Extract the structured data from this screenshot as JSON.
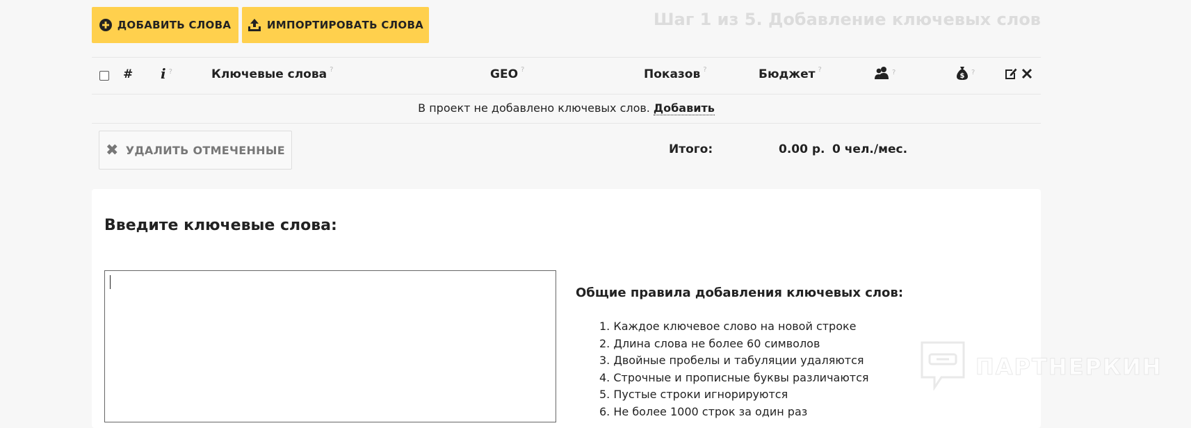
{
  "toolbar": {
    "add_label": "ДОБАВИТЬ СЛОВА",
    "import_label": "ИМПОРТИРОВАТЬ СЛОВА",
    "accent": "#ffd04d"
  },
  "step_title": "Шаг 1 из 5. Добавление ключевых слов",
  "table": {
    "columns": {
      "number": "#",
      "info": "i",
      "keywords": "Ключевые слова",
      "geo": "GEO",
      "impressions": "Показов",
      "budget": "Бюджет",
      "audience_icon": "users-icon",
      "money_icon": "money-bag-icon",
      "help": "?"
    },
    "empty_text": "В проект не добавлено ключевых слов.",
    "empty_link": "Добавить"
  },
  "delete_label": "УДАЛИТЬ ОТМЕЧЕННЫЕ",
  "totals": {
    "label": "Итого:",
    "budget": "0.00 р.",
    "audience": "0 чел./мес."
  },
  "input_section": {
    "title": "Введите ключевые слова:",
    "value": ""
  },
  "rules": {
    "title": "Общие правила добавления ключевых слов:",
    "items": [
      "1. Каждое ключевое слово на новой строке",
      "2. Длина слова не более 60 символов",
      "3. Двойные пробелы и табуляции удаляются",
      "4. Строчные и прописные буквы различаются",
      "5. Пустые строки игнорируются",
      "6. Не более 1000 строк за один раз"
    ]
  },
  "watermark": "ПАРТНЕРКИН"
}
